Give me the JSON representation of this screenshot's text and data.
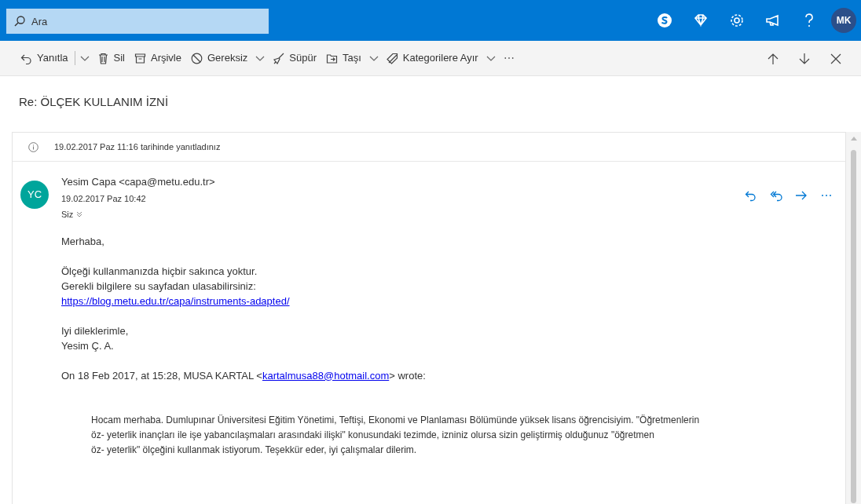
{
  "search": {
    "placeholder": "Ara"
  },
  "header_icons": [
    {
      "kind": "skype"
    },
    {
      "kind": "diamond"
    },
    {
      "kind": "settings"
    },
    {
      "kind": "megaphone"
    },
    {
      "kind": "help"
    }
  ],
  "account": {
    "initials": "MK"
  },
  "toolbar": [
    {
      "kind": "reply",
      "label": "Yanıtla",
      "dropdown": true
    },
    {
      "kind": "delete",
      "label": "Sil",
      "dropdown": false
    },
    {
      "kind": "archive",
      "label": "Arşivle",
      "dropdown": false
    },
    {
      "kind": "block",
      "label": "Gereksiz",
      "dropdown": true
    },
    {
      "kind": "sweep",
      "label": "Süpür",
      "dropdown": false
    },
    {
      "kind": "move",
      "label": "Taşı",
      "dropdown": true
    },
    {
      "kind": "tag",
      "label": "Kategorilere Ayır",
      "dropdown": true
    },
    {
      "kind": "more",
      "label": "⋯",
      "dropdown": false
    }
  ],
  "subject": "Re: ÖLÇEK KULLANIM İZNİ",
  "notice": "19.02.2017 Paz 11:16 tarihinde yanıtladınız",
  "message": {
    "avatar": "YC",
    "sender": "Yesim Capa <capa@metu.edu.tr>",
    "date": "19.02.2017 Paz 10:42",
    "to": "Siz",
    "body": [
      {
        "kind": "text",
        "lines": [
          "Merhaba,"
        ]
      },
      {
        "kind": "text",
        "lines": [
          "Ölçeği kullanmanızda hiçbir sakınca yoktur.",
          "Gerekli bilgilere su sayfadan ulasabilirsiniz:"
        ],
        "link": "https://blog.metu.edu.tr/capa/instruments-adapted/"
      },
      {
        "kind": "text",
        "lines": [
          "Iyi dileklerimle,",
          "Yesim Ç. A."
        ]
      },
      {
        "kind": "attribution",
        "before": "On 18 Feb 2017, at 15:28, MUSA KARTAL <",
        "link": "kartalmusa88@hotmail.com",
        "after": "> wrote:"
      },
      {
        "kind": "quote",
        "lines": [
          "Hocam merhaba. Dumlupınar Üniversitesi Eğitim Yönetimi, Teftişi, Ekonomi ve Planlaması Bölümünde yüksek lisans öğrencisiyim. \"Öğretmenlerin",
          "öz- yeterlik inançları ile işe yabancılaşmaları arasındaki ilişki\" konusundaki tezimde, izniniz olursa sizin geliştirmiş olduğunuz \"öğretmen",
          "öz- yeterlik\" ölçeğini kullanmak istiyorum. Teşekkür eder, iyi çalışmalar dilerim."
        ]
      }
    ]
  }
}
